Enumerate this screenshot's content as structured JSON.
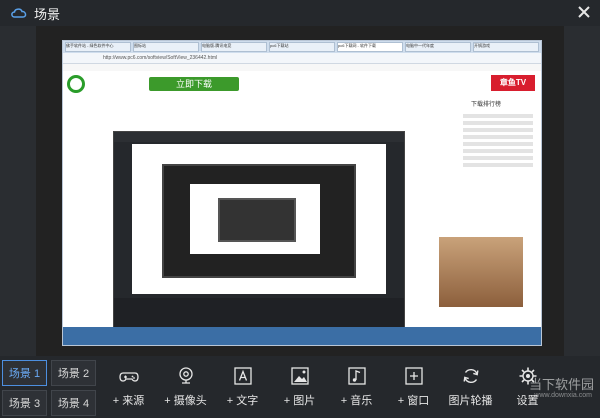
{
  "window": {
    "title": "场景"
  },
  "browser": {
    "tabs": [
      "佛手软件站 - 绿色软件中心",
      "图标站",
      "电脑版-腾讯电竞",
      "pc6下载站",
      "pc6下载网 - 软件下载",
      "电脑中一代年度",
      "开锅游戏"
    ],
    "url": "http://www.pc6.com/softview/SoftView_236442.html",
    "download_label": "立即下载",
    "badge": "章鱼TV",
    "rank_title": "下载排行榜"
  },
  "scenes": [
    {
      "label": "场景 1",
      "active": true
    },
    {
      "label": "场景 2",
      "active": false
    },
    {
      "label": "场景 3",
      "active": false
    },
    {
      "label": "场景 4",
      "active": false
    }
  ],
  "tools": [
    {
      "label": "+ 来源",
      "icon": "gamepad-icon"
    },
    {
      "label": "+ 摄像头",
      "icon": "webcam-icon"
    },
    {
      "label": "+ 文字",
      "icon": "text-icon"
    },
    {
      "label": "+ 图片",
      "icon": "image-icon"
    },
    {
      "label": "+ 音乐",
      "icon": "music-icon"
    },
    {
      "label": "+ 窗口",
      "icon": "window-icon"
    },
    {
      "label": "图片轮播",
      "icon": "slideshow-icon"
    },
    {
      "label": "设置",
      "icon": "gear-icon"
    }
  ],
  "watermark": {
    "main": "当下软件园",
    "sub": "www.downxia.com"
  }
}
